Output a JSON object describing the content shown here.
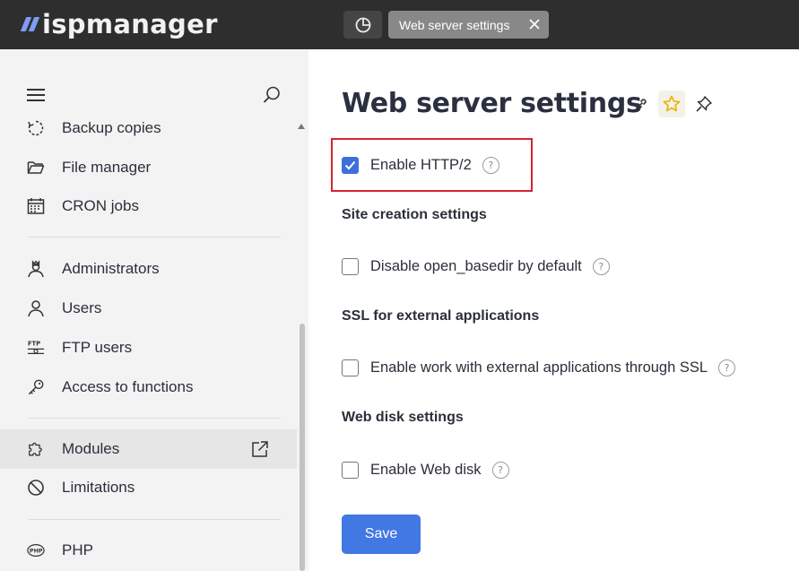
{
  "app": {
    "logo_text": "ispmanager",
    "brand_color": "#7f9cf5"
  },
  "topbar": {
    "dashboard_icon": "pie-chart-icon",
    "tab_label": "Web server settings",
    "tab_close_icon": "close-icon"
  },
  "sidebar": {
    "menu_icon": "hamburger-icon",
    "search_icon": "search-icon",
    "items": [
      {
        "label": "Backup copies",
        "icon": "backup-icon"
      },
      {
        "label": "File manager",
        "icon": "folder-icon"
      },
      {
        "label": "CRON jobs",
        "icon": "calendar-icon"
      },
      {
        "label": "Administrators",
        "icon": "admin-icon"
      },
      {
        "label": "Users",
        "icon": "user-icon"
      },
      {
        "label": "FTP users",
        "icon": "ftp-icon"
      },
      {
        "label": "Access to functions",
        "icon": "key-icon"
      },
      {
        "label": "Modules",
        "icon": "puzzle-icon",
        "active": true
      },
      {
        "label": "Limitations",
        "icon": "prohibited-icon"
      },
      {
        "label": "PHP",
        "icon": "php-icon"
      }
    ]
  },
  "main": {
    "title": "Web server settings",
    "title_icons": [
      "link-icon",
      "star-icon",
      "pin-icon"
    ],
    "options": {
      "http2": {
        "label": "Enable HTTP/2",
        "checked": true
      },
      "open_basedir": {
        "label": "Disable open_basedir by default",
        "checked": false
      },
      "ssl_external": {
        "label": "Enable work with external applications through SSL",
        "checked": false
      },
      "web_disk": {
        "label": "Enable Web disk",
        "checked": false
      }
    },
    "sections": {
      "site_creation": "Site creation settings",
      "ssl": "SSL for external applications",
      "web_disk": "Web disk settings"
    },
    "help_glyph": "?",
    "save_label": "Save",
    "accent_color": "#4178e4",
    "highlight_color": "#d62431"
  }
}
